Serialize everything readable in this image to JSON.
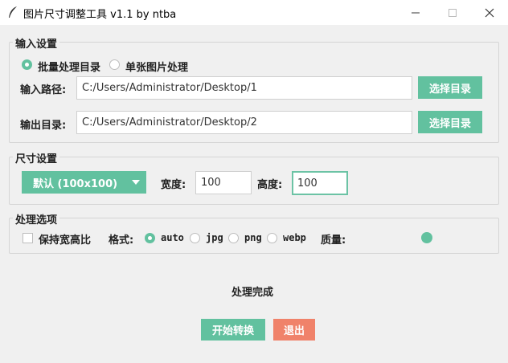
{
  "window": {
    "title": "图片尺寸调整工具 v1.1 by ntba",
    "icon": "feather-icon",
    "controls": [
      "minimize-icon",
      "maximize-icon",
      "close-icon"
    ]
  },
  "input_settings": {
    "group_label": "输入设置",
    "modes": [
      {
        "label": "批量处理目录",
        "selected": true
      },
      {
        "label": "单张图片处理",
        "selected": false
      }
    ],
    "input_path_label": "输入路径:",
    "input_path_value": "C:/Users/Administrator/Desktop/1",
    "select_dir_button_1": "选择目录",
    "output_dir_label": "输出目录:",
    "output_dir_value": "C:/Users/Administrator/Desktop/2",
    "select_dir_button_2": "选择目录"
  },
  "size_settings": {
    "group_label": "尺寸设置",
    "preset_value": "默认 (100x100)",
    "width_label": "宽度:",
    "width_value": "100",
    "height_label": "高度:",
    "height_value": "100"
  },
  "options": {
    "group_label": "处理选项",
    "keep_ratio_label": "保持宽高比",
    "keep_ratio_checked": false,
    "format_label": "格式:",
    "formats": [
      {
        "label": "auto",
        "selected": true
      },
      {
        "label": "jpg",
        "selected": false
      },
      {
        "label": "png",
        "selected": false
      },
      {
        "label": "webp",
        "selected": false
      }
    ],
    "quality_label": "质量:"
  },
  "status": "处理完成",
  "actions": {
    "start_button": "开始转换",
    "exit_button": "退出"
  },
  "colors": {
    "accent": "#62c19f",
    "danger": "#f0826a",
    "background": "#f0f0f0"
  }
}
